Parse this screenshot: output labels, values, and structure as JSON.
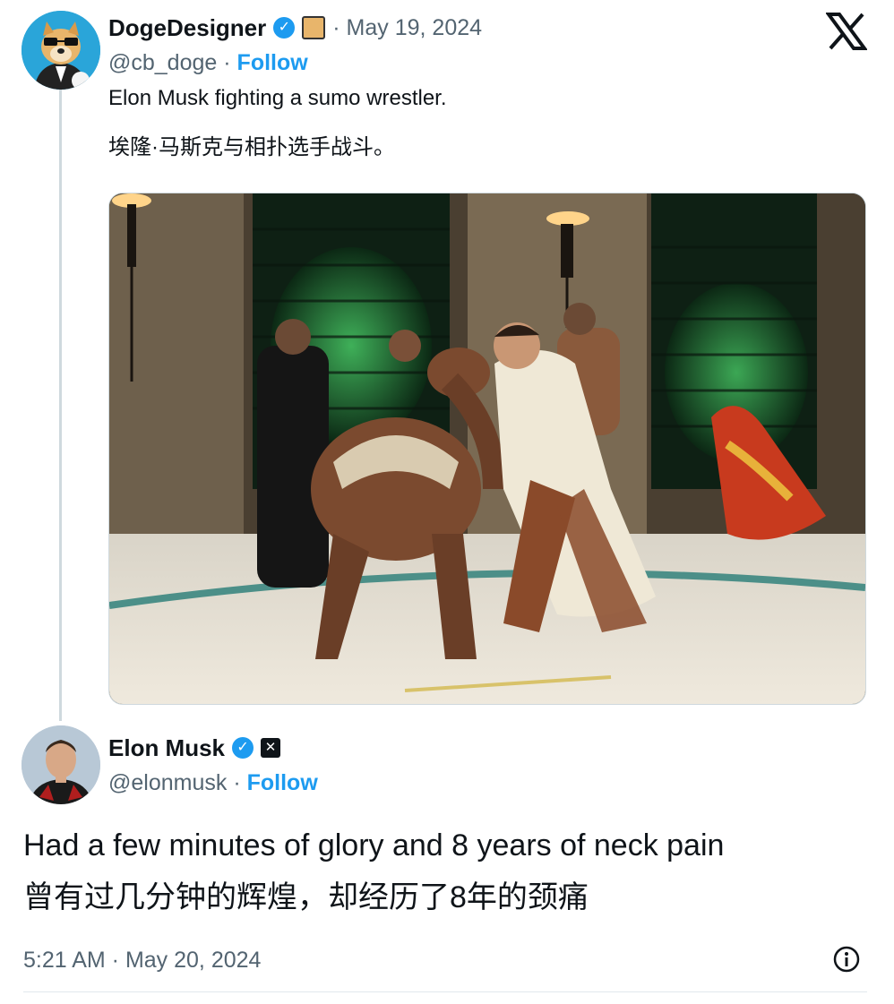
{
  "quoted_tweet": {
    "author_name": "DogeDesigner",
    "handle": "@cb_doge",
    "date": "· May 19, 2024",
    "follow_label": "Follow",
    "text_en": "Elon Musk fighting a sumo wrestler.",
    "text_zh": "埃隆·马斯克与相扑选手战斗。",
    "media_alt": "Photo of a man in a white robe grappling with a sumo wrestler on a mat"
  },
  "reply_tweet": {
    "author_name": "Elon Musk",
    "handle": "@elonmusk",
    "follow_label": "Follow",
    "text_en": "Had a few minutes of glory and 8 years of neck pain",
    "text_zh": "曾有过几分钟的辉煌，却经历了8年的颈痛",
    "timestamp": "5:21 AM · May 20, 2024"
  },
  "icons": {
    "x_logo": "x-logo-icon",
    "verified": "verified-badge-icon",
    "info": "info-icon"
  },
  "colors": {
    "accent": "#1d9bf0",
    "muted": "#536471",
    "text": "#0f1419",
    "thread_line": "#cfd9de"
  }
}
